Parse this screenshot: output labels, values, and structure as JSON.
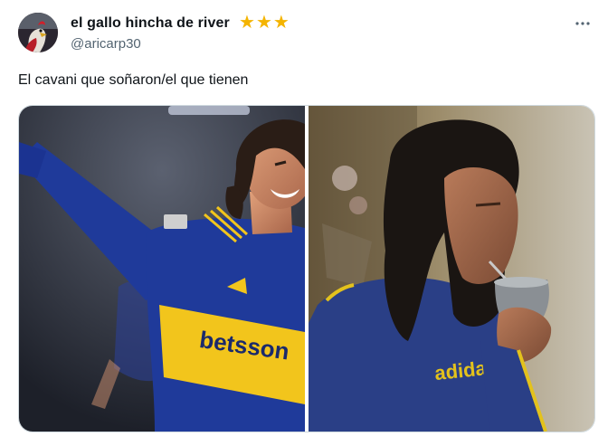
{
  "author": {
    "display_name": "el gallo hincha de river",
    "handle": "@aricarp30",
    "badge_icons": [
      "star-icon",
      "star-icon",
      "star-icon"
    ],
    "avatar_icon": "rooster-avatar"
  },
  "menu": {
    "icon": "more-options-icon"
  },
  "tweet": {
    "text": "El cavani que soñaron/el que tienen"
  },
  "media": {
    "left": {
      "jersey_sponsor": "betsson"
    },
    "right": {
      "shirt_text": "adidas"
    }
  },
  "colors": {
    "star": "#f4b400",
    "handle": "#536471",
    "boca_blue": "#1f3a9a",
    "boca_yellow": "#f2c51c"
  }
}
